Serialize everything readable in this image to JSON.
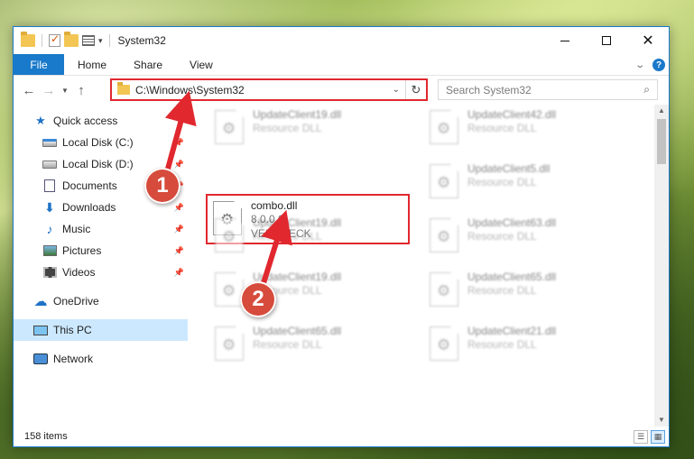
{
  "window": {
    "title": "System32",
    "controls": {
      "minimize": "minimize",
      "maximize": "maximize",
      "close": "✕"
    }
  },
  "ribbon": {
    "file_tab": "File",
    "tabs": [
      "Home",
      "Share",
      "View"
    ]
  },
  "address": {
    "path": "C:\\Windows\\System32",
    "search_placeholder": "Search System32"
  },
  "sidebar": {
    "quick_access": "Quick access",
    "items": [
      {
        "label": "Local Disk (C:)",
        "icon": "drive-c-icon",
        "pinned": true
      },
      {
        "label": "Local Disk (D:)",
        "icon": "drive-d-icon",
        "pinned": true
      },
      {
        "label": "Documents",
        "icon": "documents-icon",
        "pinned": true
      },
      {
        "label": "Downloads",
        "icon": "downloads-icon",
        "pinned": true
      },
      {
        "label": "Music",
        "icon": "music-icon",
        "pinned": true
      },
      {
        "label": "Pictures",
        "icon": "pictures-icon",
        "pinned": true
      },
      {
        "label": "Videos",
        "icon": "videos-icon",
        "pinned": true
      }
    ],
    "onedrive": "OneDrive",
    "this_pc": "This PC",
    "network": "Network"
  },
  "files": {
    "highlighted": {
      "name": "combo.dll",
      "version": "8.0.0.0",
      "description": "VERCHECK"
    },
    "blurred": [
      {
        "name": "UpdateClient19.dll",
        "type": "Resource DLL"
      },
      {
        "name": "UpdateClient42.dll",
        "type": "Resource DLL"
      },
      {
        "name": "UpdateClient5.dll",
        "type": "Resource DLL"
      },
      {
        "name": "UpdateClient19.dll",
        "type": "Resource DLL"
      },
      {
        "name": "UpdateClient63.dll",
        "type": "Resource DLL"
      },
      {
        "name": "UpdateClient19.dll",
        "type": "Resource DLL"
      },
      {
        "name": "UpdateClient65.dll",
        "type": "Resource DLL"
      },
      {
        "name": "UpdateClient65.dll",
        "type": "Resource DLL"
      },
      {
        "name": "UpdateClient21.dll",
        "type": "Resource DLL"
      }
    ]
  },
  "status": {
    "items_count": "158 items"
  },
  "annotations": {
    "step1": "1",
    "step2": "2",
    "color": "#e0282e"
  }
}
